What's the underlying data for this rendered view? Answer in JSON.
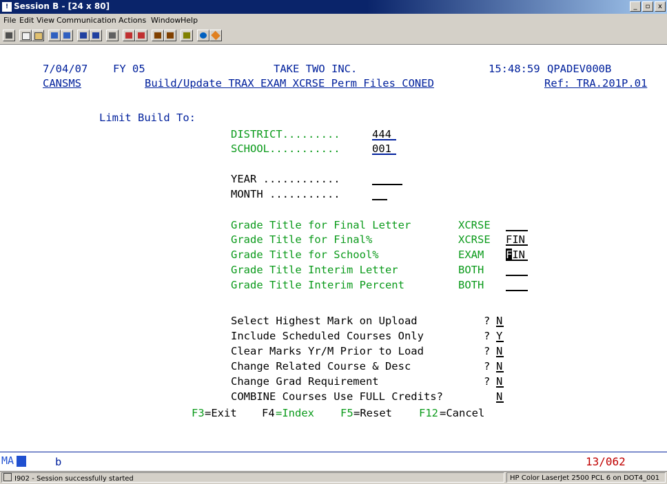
{
  "window": {
    "title": "Session B - [24 x 80]",
    "min": "_",
    "max": "▫",
    "close": "x"
  },
  "menu": [
    "File",
    "Edit",
    "View",
    "Communication",
    "Actions",
    "Window",
    "Help"
  ],
  "toolbar_icons": [
    "print-screen-icon",
    "copy-icon",
    "paste-icon",
    "send-file-icon",
    "receive-file-icon",
    "display-icon",
    "keypad-icon",
    "macro-icon",
    "record-icon",
    "play-icon",
    "stop-icon",
    "color-icon",
    "map-icon",
    "help-icon",
    "web-icon"
  ],
  "header": {
    "date": "7/04/07",
    "fy": "FY 05",
    "company": "TAKE TWO INC.",
    "time": "15:48:59",
    "host": "QPADEV000B",
    "program": "CANSMS",
    "screen_title": "Build/Update TRAX EXAM XCRSE Perm Files CONED",
    "ref": "Ref: TRA.201P.01"
  },
  "limit_label": "Limit Build To:",
  "district": {
    "label": "DISTRICT.........",
    "value": "444"
  },
  "school": {
    "label": "SCHOOL...........",
    "value": "001"
  },
  "year": {
    "label": "YEAR ............",
    "value": ""
  },
  "month": {
    "label": "MONTH ...........",
    "value": ""
  },
  "grades": [
    {
      "label": "Grade Title for Final Letter",
      "type": "XCRSE",
      "value": ""
    },
    {
      "label": "Grade Title for Final%",
      "type": "XCRSE",
      "value": "FIN"
    },
    {
      "label": "Grade Title for School%",
      "type": "EXAM",
      "value_cursor": "F",
      "value_rest": "IN"
    },
    {
      "label": "Grade Title Interim Letter",
      "type": "BOTH",
      "value": ""
    },
    {
      "label": "Grade Title Interim Percent",
      "type": "BOTH",
      "value": ""
    }
  ],
  "options": [
    {
      "label": "Select Highest Mark on Upload",
      "q": "?",
      "value": "N"
    },
    {
      "label": "Include Scheduled Courses Only",
      "q": "?",
      "value": "Y"
    },
    {
      "label": "Clear Marks Yr/M Prior to Load",
      "q": "?",
      "value": "N"
    },
    {
      "label": "Change Related Course & Desc",
      "q": "?",
      "value": "N"
    },
    {
      "label": "Change Grad Requirement",
      "q": "?",
      "value": "N"
    },
    {
      "label": "COMBINE Courses Use FULL Credits?",
      "q": "",
      "value": "N"
    }
  ],
  "fkeys": {
    "f3_key": "F3",
    "f3_label": "=Exit",
    "f4_key": "F4",
    "f4_label": "=Index",
    "f5_key": "F5",
    "f5_label": "=Reset",
    "f12_key": "F12",
    "f12_label": "=Cancel"
  },
  "oia": {
    "mode": "MA",
    "indicator": "b",
    "cursor_pos": "13/062"
  },
  "status": {
    "message": "I902 - Session successfully started",
    "printer": "HP Color LaserJet 2500 PCL 6 on DOT4_001"
  },
  "colors": {
    "blue": "#00209c",
    "green": "#0a9a1a",
    "red": "#c00000",
    "titlebar": "#0a246a"
  }
}
